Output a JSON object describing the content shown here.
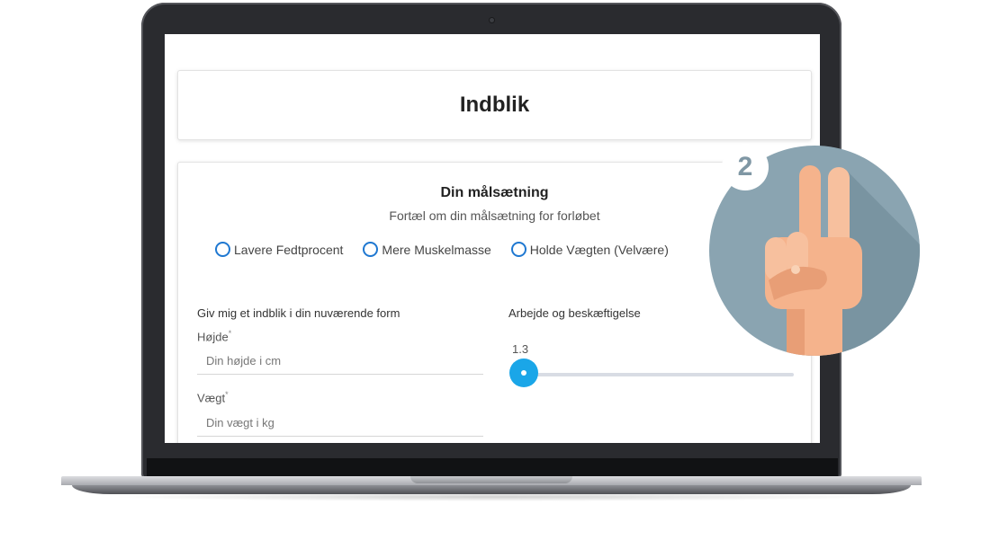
{
  "page": {
    "title": "Indblik"
  },
  "goal": {
    "title": "Din målsætning",
    "subtitle": "Fortæl om din målsætning for forløbet",
    "options": [
      {
        "label": "Lavere Fedtprocent"
      },
      {
        "label": "Mere Muskelmasse"
      },
      {
        "label": "Holde Vægten (Velvære)"
      }
    ]
  },
  "form": {
    "section_title": "Giv mig et indblik i din nuværende form",
    "height": {
      "label": "Højde",
      "required_mark": "*",
      "placeholder": "Din højde i cm"
    },
    "weight": {
      "label": "Vægt",
      "required_mark": "*",
      "placeholder": "Din vægt i kg"
    }
  },
  "work": {
    "section_title": "Arbejde og beskæftigelse",
    "slider_value": "1.3"
  },
  "badge": {
    "step_number": "2",
    "icon": "two-fingers-hand-icon"
  },
  "colors": {
    "accent": "#1f78d1",
    "slider": "#1aa6e8",
    "badge_bg": "#8aa4b1",
    "skin": "#f5b38c"
  }
}
